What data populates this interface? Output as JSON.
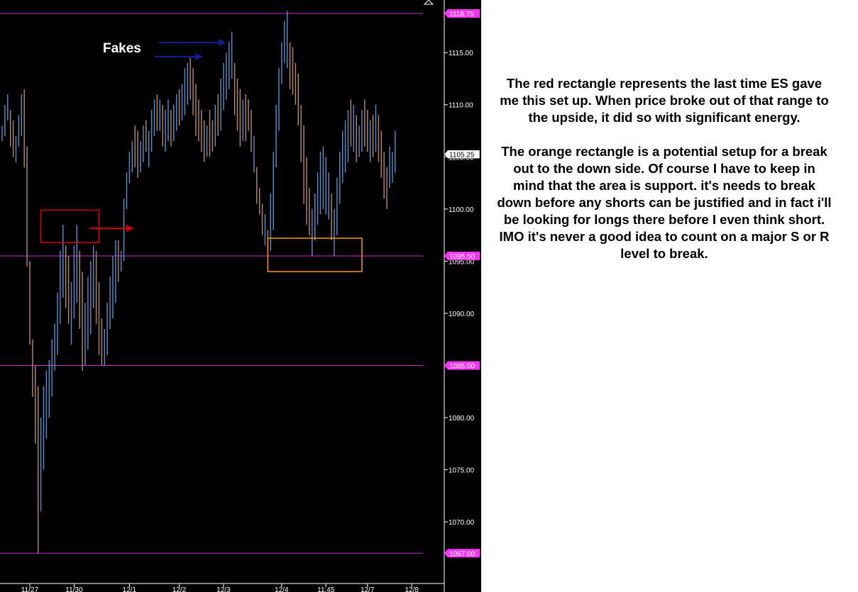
{
  "colors": {
    "background": "#000000",
    "level_line": "#cc33cc",
    "level_tag": "#ff33ff",
    "bar_up": "#5b8fd0",
    "bar_down": "#b98a6a",
    "red_box": "#dd0000",
    "orange_box": "#ff9900",
    "blue_arrow": "#101c9a",
    "red_arrow": "#cc0000",
    "text_panel": "#ffffff",
    "axis_text": "#ffffff"
  },
  "commentary": {
    "paragraph1": "The red rectangle represents the last time ES gave me this set up. When price broke out of that range to the upside, it did so with significant energy.",
    "paragraph2": "The orange rectangle is a potential setup for a break out to the down side. Of course I have to keep in mind that the area is support. it's needs to break down before any shorts can be justified and in fact i'll be looking for longs there before I even think short. IMO it's never a good idea to count on a major S or R level to break."
  },
  "chart_data": {
    "type": "ohlc",
    "instrument": "ES",
    "ylim": [
      1066,
      1119.5
    ],
    "y_ticks": [
      1115,
      1110,
      1105,
      1100,
      1095,
      1090,
      1085,
      1080,
      1075,
      1070
    ],
    "y_tick_labels": [
      "1115.00",
      "1110.00",
      "1105.00",
      "1100.00",
      "1095.00",
      "1090.00",
      "1085.00",
      "1080.00",
      "1075.00",
      "1070.00"
    ],
    "last_price": 1105.25,
    "last_price_label": "1105.25",
    "levels": [
      {
        "value": 1118.75,
        "label": "1118.75"
      },
      {
        "value": 1095.5,
        "label": "1095.50"
      },
      {
        "value": 1085.0,
        "label": "1085.00"
      },
      {
        "value": 1067.0,
        "label": "1067.00"
      }
    ],
    "x_labels": [
      {
        "bar": 10,
        "label": "11/27"
      },
      {
        "bar": 26,
        "label": "11/30"
      },
      {
        "bar": 46,
        "label": "12/1"
      },
      {
        "bar": 64,
        "label": "12/2"
      },
      {
        "bar": 80,
        "label": "12/3"
      },
      {
        "bar": 101,
        "label": "12/4"
      },
      {
        "bar": 117,
        "label": "11:45"
      },
      {
        "bar": 132,
        "label": "12/7"
      },
      {
        "bar": 148,
        "label": "12/8"
      }
    ],
    "annotations": {
      "fakes_label": "Fakes",
      "red_box": {
        "bar_start": 14,
        "bar_end": 35,
        "y_low": 1096.8,
        "y_high": 1099.9
      },
      "orange_box": {
        "bar_start": 96,
        "bar_end": 130,
        "y_low": 1094.0,
        "y_high": 1097.2
      }
    },
    "bars": [
      {
        "h": 1108.0,
        "l": 1106.5,
        "up": true
      },
      {
        "h": 1110.0,
        "l": 1107.0,
        "up": true
      },
      {
        "h": 1111.0,
        "l": 1108.5,
        "up": true
      },
      {
        "h": 1109.5,
        "l": 1106.0,
        "up": false
      },
      {
        "h": 1108.5,
        "l": 1105.0,
        "up": false
      },
      {
        "h": 1107.0,
        "l": 1104.5,
        "up": true
      },
      {
        "h": 1109.0,
        "l": 1106.0,
        "up": true
      },
      {
        "h": 1111.0,
        "l": 1107.0,
        "up": true
      },
      {
        "h": 1111.5,
        "l": 1104.0,
        "up": false
      },
      {
        "h": 1106.0,
        "l": 1094.5,
        "up": false
      },
      {
        "h": 1095.0,
        "l": 1087.0,
        "up": false
      },
      {
        "h": 1087.5,
        "l": 1082.0,
        "up": false
      },
      {
        "h": 1085.0,
        "l": 1077.5,
        "up": false
      },
      {
        "h": 1083.0,
        "l": 1067.0,
        "up": false
      },
      {
        "h": 1080.0,
        "l": 1071.0,
        "up": true
      },
      {
        "h": 1083.0,
        "l": 1075.0,
        "up": true
      },
      {
        "h": 1084.5,
        "l": 1078.0,
        "up": true
      },
      {
        "h": 1085.5,
        "l": 1080.0,
        "up": true
      },
      {
        "h": 1087.5,
        "l": 1082.0,
        "up": true
      },
      {
        "h": 1089.0,
        "l": 1084.5,
        "up": true
      },
      {
        "h": 1092.0,
        "l": 1086.0,
        "up": true
      },
      {
        "h": 1096.0,
        "l": 1089.0,
        "up": true
      },
      {
        "h": 1098.5,
        "l": 1091.5,
        "up": true
      },
      {
        "h": 1096.5,
        "l": 1090.5,
        "up": false
      },
      {
        "h": 1095.5,
        "l": 1089.0,
        "up": false
      },
      {
        "h": 1093.0,
        "l": 1087.0,
        "up": true
      },
      {
        "h": 1096.5,
        "l": 1089.5,
        "up": true
      },
      {
        "h": 1098.5,
        "l": 1091.0,
        "up": true
      },
      {
        "h": 1096.0,
        "l": 1088.5,
        "up": false
      },
      {
        "h": 1094.0,
        "l": 1084.5,
        "up": false
      },
      {
        "h": 1091.0,
        "l": 1085.0,
        "up": true
      },
      {
        "h": 1093.5,
        "l": 1086.5,
        "up": true
      },
      {
        "h": 1095.0,
        "l": 1088.0,
        "up": true
      },
      {
        "h": 1096.5,
        "l": 1090.5,
        "up": true
      },
      {
        "h": 1096.0,
        "l": 1089.0,
        "up": false
      },
      {
        "h": 1093.0,
        "l": 1086.0,
        "up": false
      },
      {
        "h": 1089.5,
        "l": 1085.0,
        "up": false
      },
      {
        "h": 1088.5,
        "l": 1085.0,
        "up": true
      },
      {
        "h": 1091.0,
        "l": 1086.0,
        "up": true
      },
      {
        "h": 1093.5,
        "l": 1088.5,
        "up": true
      },
      {
        "h": 1095.5,
        "l": 1089.5,
        "up": true
      },
      {
        "h": 1097.0,
        "l": 1091.0,
        "up": true
      },
      {
        "h": 1097.0,
        "l": 1093.0,
        "up": false
      },
      {
        "h": 1096.0,
        "l": 1094.0,
        "up": true
      },
      {
        "h": 1101.0,
        "l": 1095.0,
        "up": true
      },
      {
        "h": 1103.5,
        "l": 1100.0,
        "up": true
      },
      {
        "h": 1105.5,
        "l": 1102.5,
        "up": true
      },
      {
        "h": 1106.5,
        "l": 1103.5,
        "up": true
      },
      {
        "h": 1108.0,
        "l": 1104.0,
        "up": false
      },
      {
        "h": 1107.5,
        "l": 1103.0,
        "up": false
      },
      {
        "h": 1106.5,
        "l": 1103.5,
        "up": true
      },
      {
        "h": 1108.0,
        "l": 1104.5,
        "up": true
      },
      {
        "h": 1108.5,
        "l": 1105.5,
        "up": false
      },
      {
        "h": 1107.5,
        "l": 1104.0,
        "up": true
      },
      {
        "h": 1109.5,
        "l": 1105.5,
        "up": true
      },
      {
        "h": 1110.5,
        "l": 1107.0,
        "up": true
      },
      {
        "h": 1111.0,
        "l": 1107.5,
        "up": false
      },
      {
        "h": 1110.5,
        "l": 1107.5,
        "up": true
      },
      {
        "h": 1110.0,
        "l": 1106.0,
        "up": false
      },
      {
        "h": 1109.5,
        "l": 1105.5,
        "up": true
      },
      {
        "h": 1110.5,
        "l": 1106.5,
        "up": true
      },
      {
        "h": 1109.5,
        "l": 1106.0,
        "up": false
      },
      {
        "h": 1110.0,
        "l": 1106.5,
        "up": true
      },
      {
        "h": 1111.0,
        "l": 1107.5,
        "up": true
      },
      {
        "h": 1111.5,
        "l": 1108.0,
        "up": false
      },
      {
        "h": 1112.0,
        "l": 1108.5,
        "up": true
      },
      {
        "h": 1113.5,
        "l": 1109.0,
        "up": true
      },
      {
        "h": 1114.0,
        "l": 1110.0,
        "up": true
      },
      {
        "h": 1114.5,
        "l": 1110.5,
        "up": false
      },
      {
        "h": 1113.5,
        "l": 1109.0,
        "up": false
      },
      {
        "h": 1112.0,
        "l": 1107.0,
        "up": false
      },
      {
        "h": 1110.5,
        "l": 1106.5,
        "up": false
      },
      {
        "h": 1109.5,
        "l": 1105.5,
        "up": false
      },
      {
        "h": 1108.5,
        "l": 1104.5,
        "up": false
      },
      {
        "h": 1108.0,
        "l": 1105.0,
        "up": true
      },
      {
        "h": 1109.5,
        "l": 1105.0,
        "up": false
      },
      {
        "h": 1108.5,
        "l": 1105.5,
        "up": false
      },
      {
        "h": 1110.0,
        "l": 1106.0,
        "up": true
      },
      {
        "h": 1111.0,
        "l": 1107.0,
        "up": false
      },
      {
        "h": 1112.5,
        "l": 1107.5,
        "up": true
      },
      {
        "h": 1114.0,
        "l": 1109.5,
        "up": true
      },
      {
        "h": 1115.0,
        "l": 1110.5,
        "up": true
      },
      {
        "h": 1116.0,
        "l": 1111.5,
        "up": true
      },
      {
        "h": 1117.0,
        "l": 1112.5,
        "up": true
      },
      {
        "h": 1114.0,
        "l": 1109.0,
        "up": false
      },
      {
        "h": 1112.5,
        "l": 1107.5,
        "up": false
      },
      {
        "h": 1111.5,
        "l": 1106.0,
        "up": false
      },
      {
        "h": 1110.5,
        "l": 1106.5,
        "up": true
      },
      {
        "h": 1111.0,
        "l": 1106.5,
        "up": false
      },
      {
        "h": 1110.5,
        "l": 1107.5,
        "up": false
      },
      {
        "h": 1109.5,
        "l": 1105.5,
        "up": false
      },
      {
        "h": 1107.0,
        "l": 1103.5,
        "up": true
      },
      {
        "h": 1104.0,
        "l": 1100.5,
        "up": false
      },
      {
        "h": 1102.0,
        "l": 1099.5,
        "up": false
      },
      {
        "h": 1100.5,
        "l": 1097.5,
        "up": false
      },
      {
        "h": 1099.5,
        "l": 1096.5,
        "up": true
      },
      {
        "h": 1098.0,
        "l": 1096.0,
        "up": false
      },
      {
        "h": 1101.5,
        "l": 1096.0,
        "up": true
      },
      {
        "h": 1105.5,
        "l": 1098.0,
        "up": true
      },
      {
        "h": 1110.0,
        "l": 1104.0,
        "up": true
      },
      {
        "h": 1113.5,
        "l": 1107.5,
        "up": true
      },
      {
        "h": 1116.0,
        "l": 1112.0,
        "up": true
      },
      {
        "h": 1118.0,
        "l": 1114.0,
        "up": true
      },
      {
        "h": 1119.0,
        "l": 1113.5,
        "up": true
      },
      {
        "h": 1116.0,
        "l": 1111.5,
        "up": false
      },
      {
        "h": 1115.5,
        "l": 1111.0,
        "up": false
      },
      {
        "h": 1114.0,
        "l": 1110.0,
        "up": false
      },
      {
        "h": 1113.0,
        "l": 1108.0,
        "up": false
      },
      {
        "h": 1110.0,
        "l": 1104.5,
        "up": false
      },
      {
        "h": 1108.0,
        "l": 1100.5,
        "up": false
      },
      {
        "h": 1105.0,
        "l": 1098.5,
        "up": false
      },
      {
        "h": 1102.0,
        "l": 1097.5,
        "up": false
      },
      {
        "h": 1100.0,
        "l": 1095.5,
        "up": true
      },
      {
        "h": 1101.5,
        "l": 1097.0,
        "up": true
      },
      {
        "h": 1103.5,
        "l": 1098.5,
        "up": true
      },
      {
        "h": 1105.5,
        "l": 1099.5,
        "up": true
      },
      {
        "h": 1106.0,
        "l": 1100.0,
        "up": true
      },
      {
        "h": 1105.0,
        "l": 1099.5,
        "up": true
      },
      {
        "h": 1103.5,
        "l": 1099.0,
        "up": true
      },
      {
        "h": 1101.5,
        "l": 1097.0,
        "up": false
      },
      {
        "h": 1100.0,
        "l": 1095.5,
        "up": true
      },
      {
        "h": 1103.0,
        "l": 1097.5,
        "up": true
      },
      {
        "h": 1105.5,
        "l": 1100.5,
        "up": true
      },
      {
        "h": 1107.5,
        "l": 1102.5,
        "up": true
      },
      {
        "h": 1108.5,
        "l": 1103.5,
        "up": true
      },
      {
        "h": 1109.5,
        "l": 1104.5,
        "up": true
      },
      {
        "h": 1110.5,
        "l": 1106.0,
        "up": false
      },
      {
        "h": 1110.0,
        "l": 1105.5,
        "up": true
      },
      {
        "h": 1109.0,
        "l": 1104.5,
        "up": false
      },
      {
        "h": 1108.0,
        "l": 1105.0,
        "up": true
      },
      {
        "h": 1109.5,
        "l": 1105.5,
        "up": true
      },
      {
        "h": 1110.5,
        "l": 1106.0,
        "up": false
      },
      {
        "h": 1109.5,
        "l": 1105.5,
        "up": false
      },
      {
        "h": 1108.5,
        "l": 1104.5,
        "up": true
      },
      {
        "h": 1109.0,
        "l": 1105.0,
        "up": false
      },
      {
        "h": 1110.0,
        "l": 1105.5,
        "up": true
      },
      {
        "h": 1109.0,
        "l": 1104.5,
        "up": false
      },
      {
        "h": 1107.5,
        "l": 1103.0,
        "up": false
      },
      {
        "h": 1105.5,
        "l": 1101.0,
        "up": false
      },
      {
        "h": 1104.0,
        "l": 1100.0,
        "up": false
      },
      {
        "h": 1106.0,
        "l": 1102.0,
        "up": true
      },
      {
        "h": 1105.5,
        "l": 1102.5,
        "up": true
      },
      {
        "h": 1107.5,
        "l": 1103.5,
        "up": true
      }
    ]
  }
}
